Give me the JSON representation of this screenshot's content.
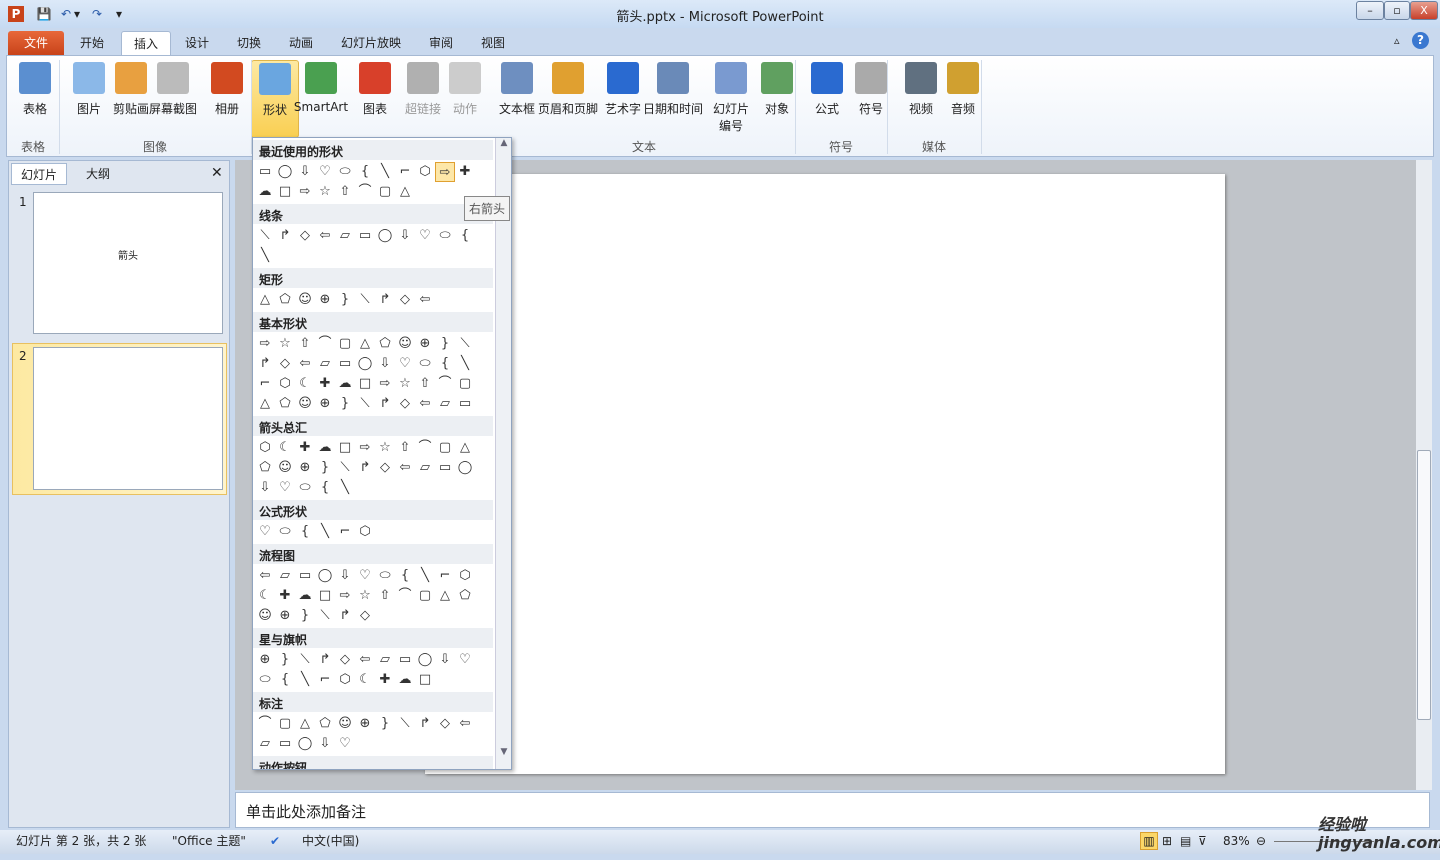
{
  "window": {
    "title": "箭头.pptx - Microsoft PowerPoint",
    "minimize": "–",
    "restore": "▫",
    "close": "X"
  },
  "quick_access": [
    "P",
    "💾",
    "↶",
    "▾",
    "↷",
    "▾"
  ],
  "tabs": [
    {
      "label": "文件"
    },
    {
      "label": "开始"
    },
    {
      "label": "插入"
    },
    {
      "label": "设计"
    },
    {
      "label": "切换"
    },
    {
      "label": "动画"
    },
    {
      "label": "幻灯片放映"
    },
    {
      "label": "审阅"
    },
    {
      "label": "视图"
    }
  ],
  "ribbon": {
    "buttons": [
      {
        "label": "表格",
        "color": "#5b8fd0"
      },
      {
        "label": "图片",
        "color": "#8bb8e8"
      },
      {
        "label": "剪贴画",
        "color": "#e8a040"
      },
      {
        "label": "屏幕截图",
        "color": "#bbbbbb"
      },
      {
        "label": "相册",
        "color": "#d24a20"
      },
      {
        "label": "形状",
        "color": "#6aa6e0"
      },
      {
        "label": "SmartArt",
        "color": "#4aa050"
      },
      {
        "label": "图表",
        "color": "#d8402a"
      },
      {
        "label": "超链接",
        "color": "#b0b0b0"
      },
      {
        "label": "动作",
        "color": "#cccccc"
      },
      {
        "label": "文本框",
        "color": "#6e8fc0"
      },
      {
        "label": "页眉和页脚",
        "color": "#e0a030"
      },
      {
        "label": "艺术字",
        "color": "#2a6ad0"
      },
      {
        "label": "日期和时间",
        "color": "#6a8ab8"
      },
      {
        "label": "幻灯片编号",
        "color": "#7a9ad0"
      },
      {
        "label": "对象",
        "color": "#60a060"
      },
      {
        "label": "公式",
        "color": "#2a6ad0"
      },
      {
        "label": "符号",
        "color": "#aaaaaa"
      },
      {
        "label": "视频",
        "color": "#607080"
      },
      {
        "label": "音频",
        "color": "#d0a030"
      }
    ],
    "groups": [
      "表格",
      "图像",
      "文本",
      "符号",
      "媒体"
    ]
  },
  "gallery": {
    "tooltip": "右箭头",
    "sections": [
      {
        "title": "最近使用的形状",
        "count": 19,
        "highlight": 9
      },
      {
        "title": "线条",
        "count": 12
      },
      {
        "title": "矩形",
        "count": 9
      },
      {
        "title": "基本形状",
        "count": 44
      },
      {
        "title": "箭头总汇",
        "count": 27
      },
      {
        "title": "公式形状",
        "count": 6
      },
      {
        "title": "流程图",
        "count": 28
      },
      {
        "title": "星与旗帜",
        "count": 20
      },
      {
        "title": "标注",
        "count": 16
      },
      {
        "title": "动作按钮",
        "count": 12
      }
    ]
  },
  "left_pane": {
    "tabs": [
      "幻灯片",
      "大纲"
    ],
    "close": "✕",
    "slides": [
      {
        "num": "1",
        "text": "箭头"
      },
      {
        "num": "2",
        "text": ""
      }
    ]
  },
  "notes": {
    "placeholder": "单击此处添加备注"
  },
  "status": {
    "slide": "幻灯片 第 2 张，共 2 张",
    "theme": "\"Office 主题\"",
    "language": "中文(中国)",
    "zoom": "83%"
  },
  "watermark": "经验啦 jingyanla.com"
}
